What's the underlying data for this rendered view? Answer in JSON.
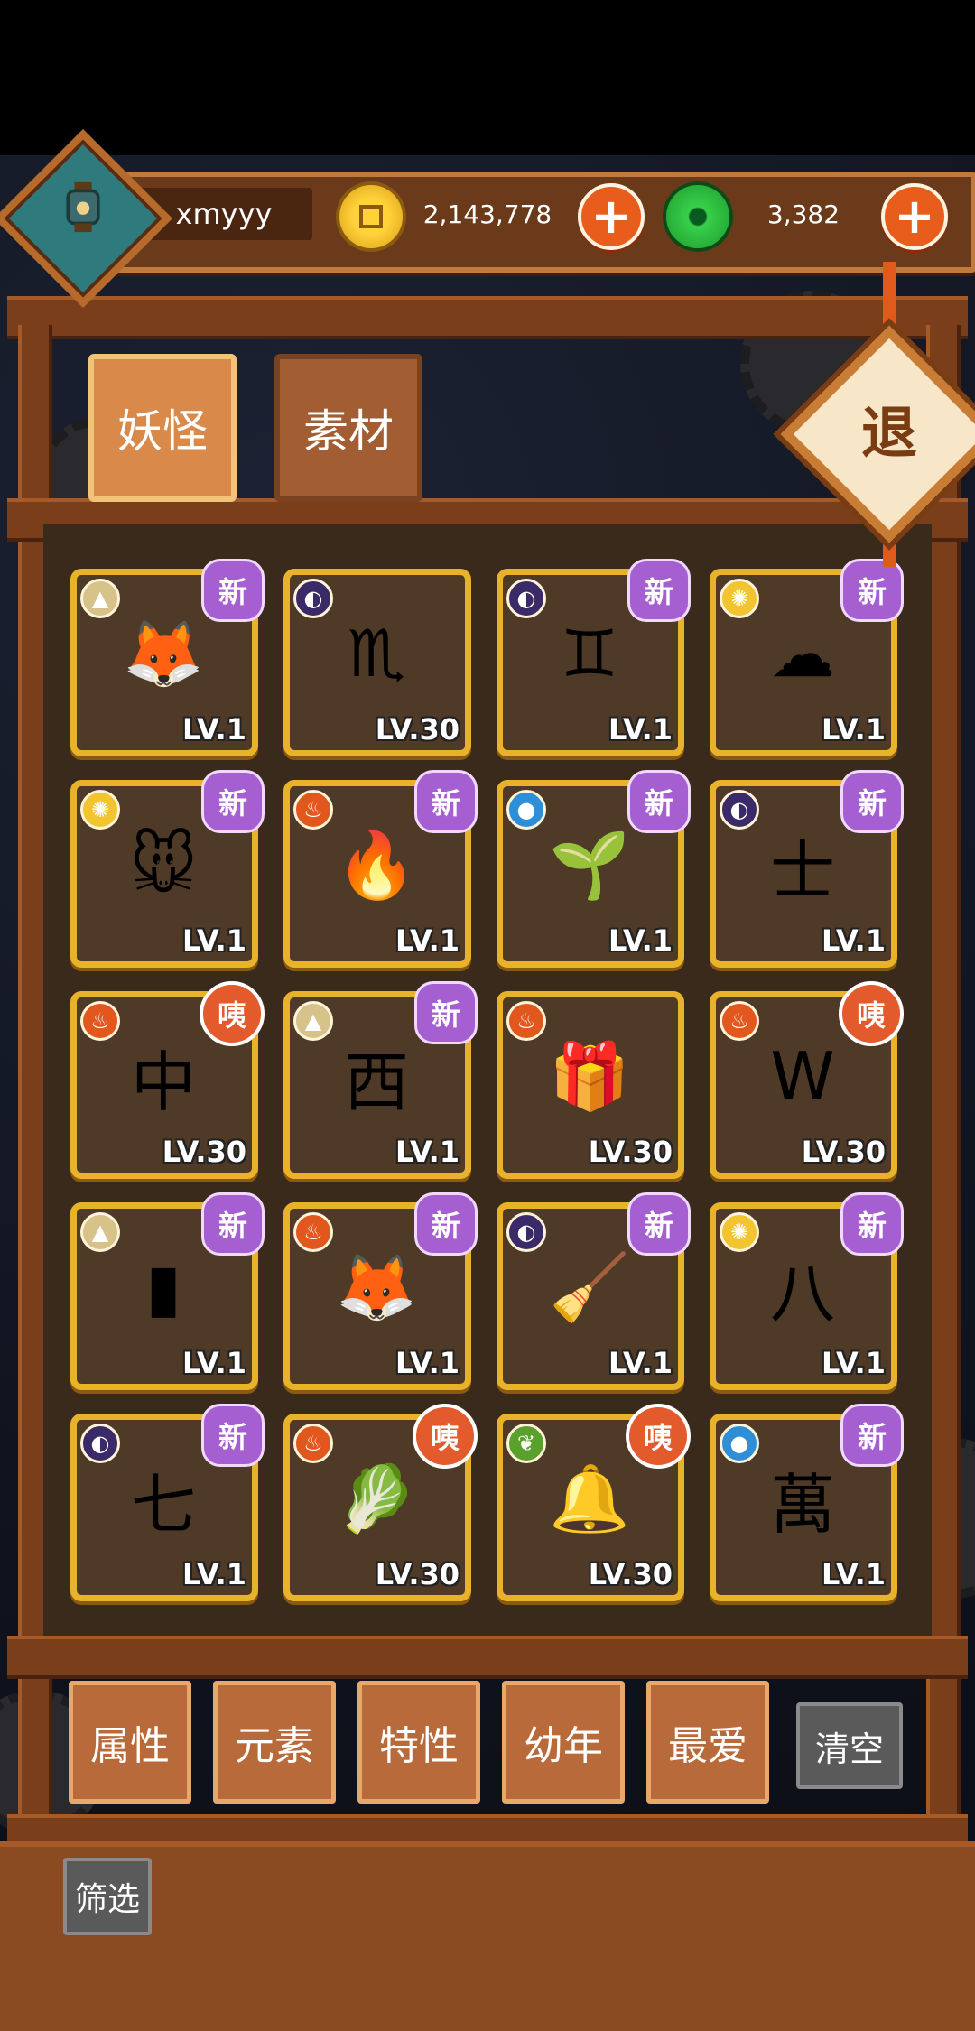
{
  "player": {
    "name": "xmyyy",
    "avatar_icon": "lantern-avatar-icon"
  },
  "currency": {
    "coins": "2,143,778",
    "jade": "3,382",
    "plus": "+"
  },
  "tabs": [
    {
      "label": "妖怪",
      "active": true
    },
    {
      "label": "素材",
      "active": false
    }
  ],
  "exit_label": "退",
  "elements": {
    "earth": {
      "color": "#d7c28a",
      "glyph": "▲"
    },
    "dark": {
      "color": "#3a2a68",
      "glyph": "◐"
    },
    "light": {
      "color": "#f2c530",
      "glyph": "✺"
    },
    "fire": {
      "color": "#e2571e",
      "glyph": "♨"
    },
    "water": {
      "color": "#2e8ed8",
      "glyph": "●"
    },
    "wood": {
      "color": "#5aa02c",
      "glyph": "❦"
    }
  },
  "badges": {
    "new": "新",
    "ugh": "咦"
  },
  "cards": [
    {
      "element": "earth",
      "badge": "new",
      "creature": "🦊",
      "level": "LV.1"
    },
    {
      "element": "dark",
      "badge": "",
      "creature": "♏",
      "level": "LV.30"
    },
    {
      "element": "dark",
      "badge": "new",
      "creature": "♊",
      "level": "LV.1"
    },
    {
      "element": "light",
      "badge": "new",
      "creature": "☁",
      "level": "LV.1"
    },
    {
      "element": "light",
      "badge": "new",
      "creature": "🐭",
      "level": "LV.1"
    },
    {
      "element": "fire",
      "badge": "new",
      "creature": "🔥",
      "level": "LV.1"
    },
    {
      "element": "water",
      "badge": "new",
      "creature": "🌱",
      "level": "LV.1"
    },
    {
      "element": "dark",
      "badge": "new",
      "creature": "士",
      "level": "LV.1"
    },
    {
      "element": "fire",
      "badge": "ugh",
      "creature": "中",
      "level": "LV.30"
    },
    {
      "element": "earth",
      "badge": "new",
      "creature": "西",
      "level": "LV.1"
    },
    {
      "element": "fire",
      "badge": "",
      "creature": "🎁",
      "level": "LV.30"
    },
    {
      "element": "fire",
      "badge": "ugh",
      "creature": "W",
      "level": "LV.30"
    },
    {
      "element": "earth",
      "badge": "new",
      "creature": "▮",
      "level": "LV.1"
    },
    {
      "element": "fire",
      "badge": "new",
      "creature": "🦊",
      "level": "LV.1"
    },
    {
      "element": "dark",
      "badge": "new",
      "creature": "🧹",
      "level": "LV.1"
    },
    {
      "element": "light",
      "badge": "new",
      "creature": "八",
      "level": "LV.1"
    },
    {
      "element": "dark",
      "badge": "new",
      "creature": "七",
      "level": "LV.1"
    },
    {
      "element": "fire",
      "badge": "ugh",
      "creature": "🥬",
      "level": "LV.30"
    },
    {
      "element": "wood",
      "badge": "ugh",
      "creature": "🔔",
      "level": "LV.30"
    },
    {
      "element": "water",
      "badge": "new",
      "creature": "萬",
      "level": "LV.1"
    }
  ],
  "filters": [
    "属性",
    "元素",
    "特性",
    "幼年",
    "最爱"
  ],
  "clear_label": "清空",
  "sift_label": "筛选"
}
